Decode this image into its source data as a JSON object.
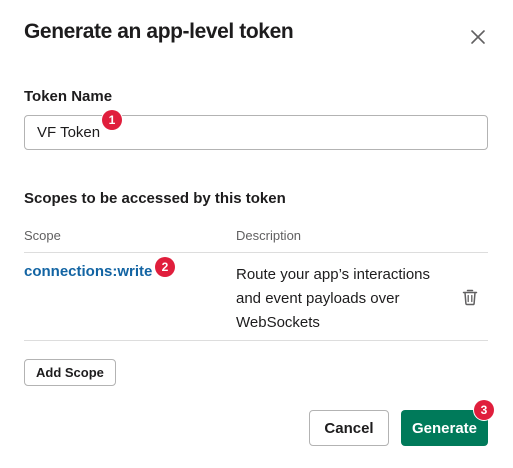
{
  "dialog": {
    "title": "Generate an app-level token",
    "close_icon": "close-icon"
  },
  "token_name": {
    "label": "Token Name",
    "value": "VF Token",
    "placeholder": ""
  },
  "scopes": {
    "section_label": "Scopes to be accessed by this token",
    "columns": {
      "scope": "Scope",
      "description": "Description"
    },
    "items": [
      {
        "scope": "connections:write",
        "description": "Route your app’s interactions and event payloads over WebSockets",
        "remove_icon": "trash-icon"
      }
    ],
    "add_label": "Add Scope"
  },
  "footer": {
    "cancel_label": "Cancel",
    "generate_label": "Generate"
  },
  "annotations": [
    {
      "number": "1"
    },
    {
      "number": "2"
    },
    {
      "number": "3"
    }
  ],
  "colors": {
    "primary_button": "#007a5a",
    "link": "#1264a3",
    "badge": "#e01e3c",
    "text": "#1d1c1d",
    "muted_text": "#616061",
    "border": "#b3b3b3"
  }
}
